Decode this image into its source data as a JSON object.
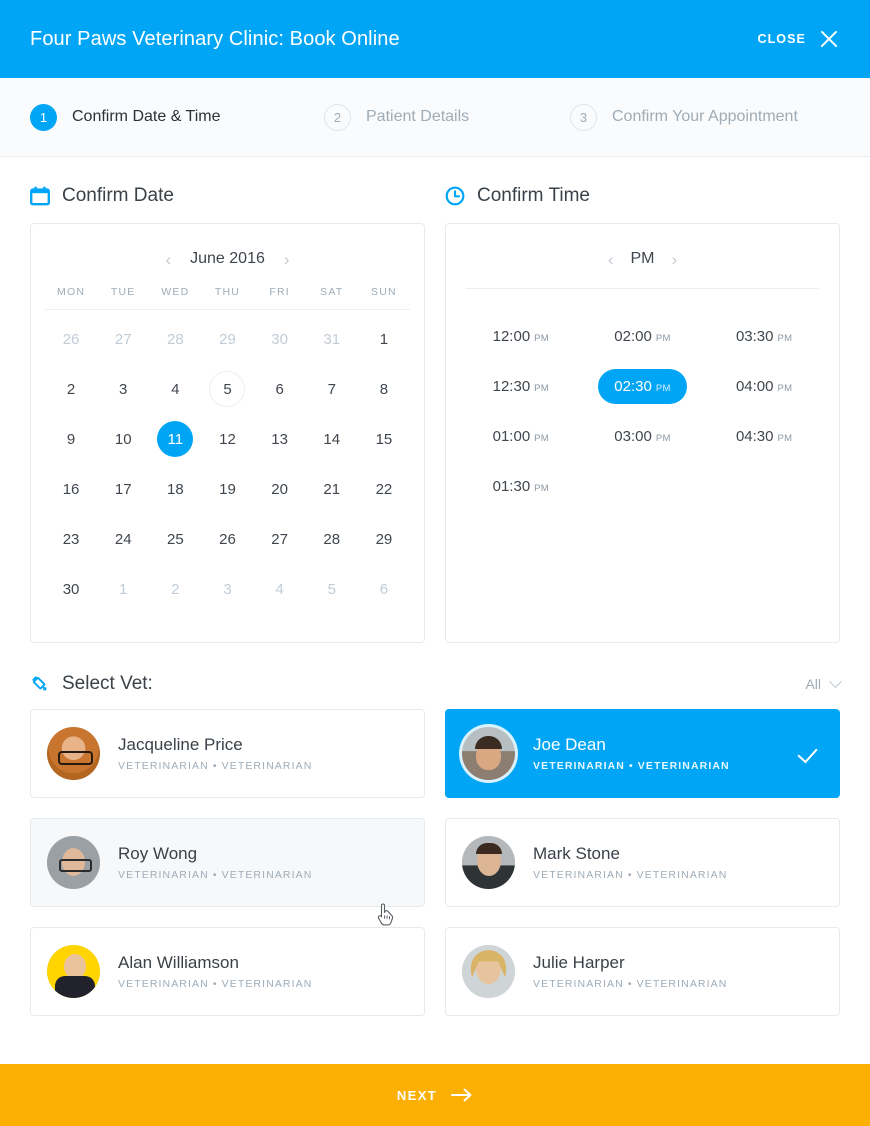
{
  "header": {
    "title": "Four Paws Veterinary Clinic: Book Online",
    "close_label": "CLOSE",
    "close_icon": "close-x-icon",
    "background_color": "#00A6F5"
  },
  "steps": [
    {
      "number": "1",
      "label": "Confirm Date & Time",
      "state": "active"
    },
    {
      "number": "2",
      "label": "Patient Details",
      "state": "inactive"
    },
    {
      "number": "3",
      "label": "Confirm Your Appointment",
      "state": "inactive"
    }
  ],
  "date_section": {
    "icon": "calendar-icon",
    "title": "Confirm Date",
    "prev_label": "‹",
    "next_label": "›",
    "month": "June 2016",
    "weekdays": [
      "MON",
      "TUE",
      "WED",
      "THU",
      "FRI",
      "SAT",
      "SUN"
    ],
    "days": [
      {
        "n": "26",
        "state": "muted"
      },
      {
        "n": "27",
        "state": "muted"
      },
      {
        "n": "28",
        "state": "muted"
      },
      {
        "n": "29",
        "state": "muted"
      },
      {
        "n": "30",
        "state": "muted"
      },
      {
        "n": "31",
        "state": "muted"
      },
      {
        "n": "1",
        "state": "normal"
      },
      {
        "n": "2",
        "state": "normal"
      },
      {
        "n": "3",
        "state": "normal"
      },
      {
        "n": "4",
        "state": "normal"
      },
      {
        "n": "5",
        "state": "today"
      },
      {
        "n": "6",
        "state": "normal"
      },
      {
        "n": "7",
        "state": "normal"
      },
      {
        "n": "8",
        "state": "normal"
      },
      {
        "n": "9",
        "state": "normal"
      },
      {
        "n": "10",
        "state": "normal"
      },
      {
        "n": "11",
        "state": "selected"
      },
      {
        "n": "12",
        "state": "normal"
      },
      {
        "n": "13",
        "state": "normal"
      },
      {
        "n": "14",
        "state": "normal"
      },
      {
        "n": "15",
        "state": "normal"
      },
      {
        "n": "16",
        "state": "normal"
      },
      {
        "n": "17",
        "state": "normal"
      },
      {
        "n": "18",
        "state": "normal"
      },
      {
        "n": "19",
        "state": "normal"
      },
      {
        "n": "20",
        "state": "normal"
      },
      {
        "n": "21",
        "state": "normal"
      },
      {
        "n": "22",
        "state": "normal"
      },
      {
        "n": "23",
        "state": "normal"
      },
      {
        "n": "24",
        "state": "normal"
      },
      {
        "n": "25",
        "state": "normal"
      },
      {
        "n": "26",
        "state": "normal"
      },
      {
        "n": "27",
        "state": "normal"
      },
      {
        "n": "28",
        "state": "normal"
      },
      {
        "n": "29",
        "state": "normal"
      },
      {
        "n": "30",
        "state": "normal"
      },
      {
        "n": "1",
        "state": "muted"
      },
      {
        "n": "2",
        "state": "muted"
      },
      {
        "n": "3",
        "state": "muted"
      },
      {
        "n": "4",
        "state": "muted"
      },
      {
        "n": "5",
        "state": "muted"
      },
      {
        "n": "6",
        "state": "muted"
      }
    ],
    "selected_day": "11",
    "today_day": "5"
  },
  "time_section": {
    "icon": "clock-icon",
    "title": "Confirm Time",
    "prev_label": "‹",
    "next_label": "›",
    "period": "PM",
    "selected_slot": "02:30 PM",
    "slots": [
      {
        "time": "12:00",
        "ampm": "PM",
        "state": "normal"
      },
      {
        "time": "02:00",
        "ampm": "PM",
        "state": "normal"
      },
      {
        "time": "03:30",
        "ampm": "PM",
        "state": "normal"
      },
      {
        "time": "12:30",
        "ampm": "PM",
        "state": "normal"
      },
      {
        "time": "02:30",
        "ampm": "PM",
        "state": "selected"
      },
      {
        "time": "04:00",
        "ampm": "PM",
        "state": "normal"
      },
      {
        "time": "01:00",
        "ampm": "PM",
        "state": "normal"
      },
      {
        "time": "03:00",
        "ampm": "PM",
        "state": "normal"
      },
      {
        "time": "04:30",
        "ampm": "PM",
        "state": "normal"
      },
      {
        "time": "01:30",
        "ampm": "PM",
        "state": "normal"
      },
      {
        "time": "",
        "ampm": "",
        "state": "empty"
      },
      {
        "time": "",
        "ampm": "",
        "state": "empty"
      }
    ]
  },
  "vet_section": {
    "icon": "syringe-icon",
    "title": "Select Vet:",
    "filter_value": "All",
    "filter_icon": "chevron-down-icon",
    "check_icon": "check-icon",
    "vets": [
      {
        "name": "Jacqueline Price",
        "role": "VETERINARIAN • VETERINARIAN",
        "state": "normal",
        "avatar": "a-jacqueline"
      },
      {
        "name": "Joe Dean",
        "role": "VETERINARIAN • VETERINARIAN",
        "state": "selected",
        "avatar": "a-joe"
      },
      {
        "name": "Roy Wong",
        "role": "VETERINARIAN • VETERINARIAN",
        "state": "hover",
        "avatar": "a-roy"
      },
      {
        "name": "Mark Stone",
        "role": "VETERINARIAN • VETERINARIAN",
        "state": "normal",
        "avatar": "a-mark"
      },
      {
        "name": "Alan Williamson",
        "role": "VETERINARIAN • VETERINARIAN",
        "state": "normal",
        "avatar": "a-alan"
      },
      {
        "name": "Julie Harper",
        "role": "VETERINARIAN • VETERINARIAN",
        "state": "normal",
        "avatar": "a-julie"
      }
    ]
  },
  "footer": {
    "next_label": "NEXT",
    "next_icon": "arrow-right-icon",
    "background_color": "#FBB003"
  },
  "colors": {
    "accent_blue": "#00A6F5",
    "next_orange": "#FBB003",
    "muted_text": "#9eacb8",
    "body_text": "#3a4148"
  }
}
